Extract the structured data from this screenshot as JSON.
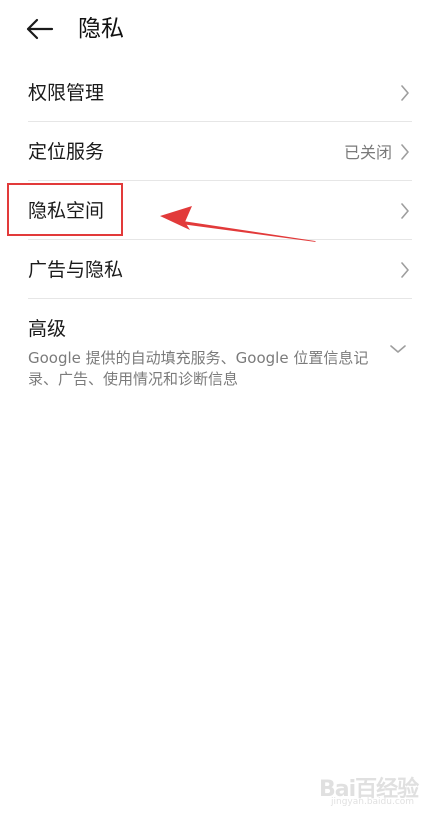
{
  "header": {
    "title": "隐私",
    "back_icon": "arrow-left-icon"
  },
  "items": [
    {
      "label": "权限管理",
      "value": ""
    },
    {
      "label": "定位服务",
      "value": "已关闭"
    },
    {
      "label": "隐私空间",
      "value": ""
    },
    {
      "label": "广告与隐私",
      "value": ""
    }
  ],
  "advanced": {
    "label": "高级",
    "subtitle": "Google 提供的自动填充服务、Google 位置信息记录、广告、使用情况和诊断信息"
  },
  "annotation": {
    "color": "#e23a3a"
  },
  "watermark": {
    "logo_text": "Bai百经验",
    "url": "jingyan.baidu.com"
  },
  "colors": {
    "text_primary": "#1a1a1a",
    "text_secondary": "#7a7a7a",
    "divider": "#e6e6e6",
    "chevron": "#9e9e9e"
  }
}
